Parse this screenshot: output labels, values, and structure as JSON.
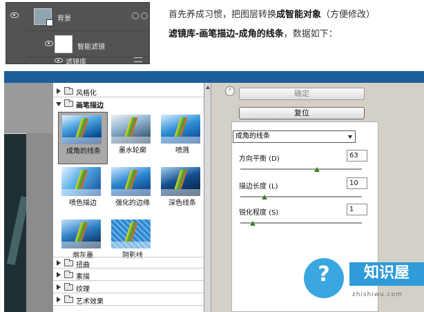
{
  "layers_panel": {
    "layer_name": "背景",
    "smart_filters_label": "智能滤镜",
    "filter_gallery_label": "滤镜库"
  },
  "intro": {
    "line1_a": "首先养成习惯，把图层转换",
    "line1_b": "成智能对象",
    "line1_c": "（方便修改）",
    "line2_a": "滤镜库-画笔描边-成角的线条",
    "line2_b": "，数据如下："
  },
  "categories_top": [
    {
      "label": "风格化",
      "expanded": false
    }
  ],
  "active_category": {
    "label": "画笔描边",
    "expanded": true
  },
  "thumbnails": [
    {
      "label": "成角的线条",
      "selected": true
    },
    {
      "label": "墨水轮廓",
      "selected": false
    },
    {
      "label": "喷溅",
      "selected": false
    },
    {
      "label": "喷色描边",
      "selected": false
    },
    {
      "label": "强化的边缘",
      "selected": false
    },
    {
      "label": "深色线条",
      "selected": false
    },
    {
      "label": "烟灰墨",
      "selected": false
    },
    {
      "label": "阴影线",
      "selected": false
    }
  ],
  "categories_bottom": [
    {
      "label": "扭曲"
    },
    {
      "label": "素描"
    },
    {
      "label": "纹理"
    },
    {
      "label": "艺术效果"
    }
  ],
  "buttons": {
    "ok": "确定",
    "reset": "复位"
  },
  "filter_select": {
    "value": "成角的线条"
  },
  "params": [
    {
      "label": "方向平衡 (D)",
      "value": "63",
      "level": 0.63
    },
    {
      "label": "描边长度 (L)",
      "value": "10",
      "level": 0.2
    },
    {
      "label": "锐化程度 (S)",
      "value": "1",
      "level": 0.1
    }
  ],
  "watermark": {
    "name": "知识屋",
    "url": "zhishiwu.com",
    "glyph": "?"
  },
  "colors": {
    "panel_bg": "#d4d0c8",
    "layers_bg": "#535353",
    "accent": "#2f9bd8"
  }
}
